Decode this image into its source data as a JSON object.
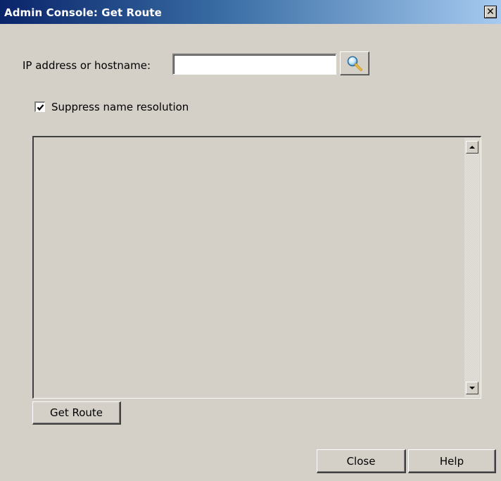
{
  "window": {
    "title": "Admin Console: Get Route",
    "close_glyph": "✕"
  },
  "form": {
    "ip_label": "IP address or hostname:",
    "ip_value": "",
    "ip_placeholder": "",
    "search_icon": "magnifier-icon",
    "suppress_label": "Suppress name resolution",
    "suppress_checked": true
  },
  "output": {
    "text": ""
  },
  "buttons": {
    "get_route": "Get Route",
    "close": "Close",
    "help": "Help"
  },
  "colors": {
    "title_start": "#0a246a",
    "title_end": "#a6caf0",
    "face": "#d4d0c8"
  }
}
